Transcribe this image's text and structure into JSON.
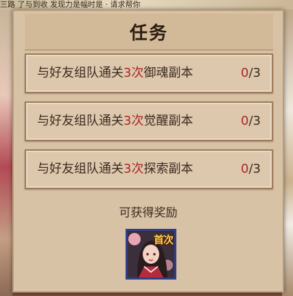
{
  "background": {
    "top_text": "三路 了与到收 发现力是幅时是 · 请求帮你"
  },
  "dialog": {
    "title": "任务",
    "tasks": [
      {
        "prefix": "与好友组队通关",
        "count": "3次",
        "suffix": "御魂副本",
        "current": "0",
        "total": "/3"
      },
      {
        "prefix": "与好友组队通关",
        "count": "3次",
        "suffix": "觉醒副本",
        "current": "0",
        "total": "/3"
      },
      {
        "prefix": "与好友组队通关",
        "count": "3次",
        "suffix": "探索副本",
        "current": "0",
        "total": "/3"
      }
    ],
    "reward_label": "可获得奖励",
    "reward": {
      "badge": "首次",
      "icon": "shikigami-portrait-icon"
    }
  },
  "colors": {
    "highlight": "#a6282a",
    "panel": "#d8c2a6",
    "text": "#3b2a20",
    "reward_border": "#2f3e88"
  }
}
